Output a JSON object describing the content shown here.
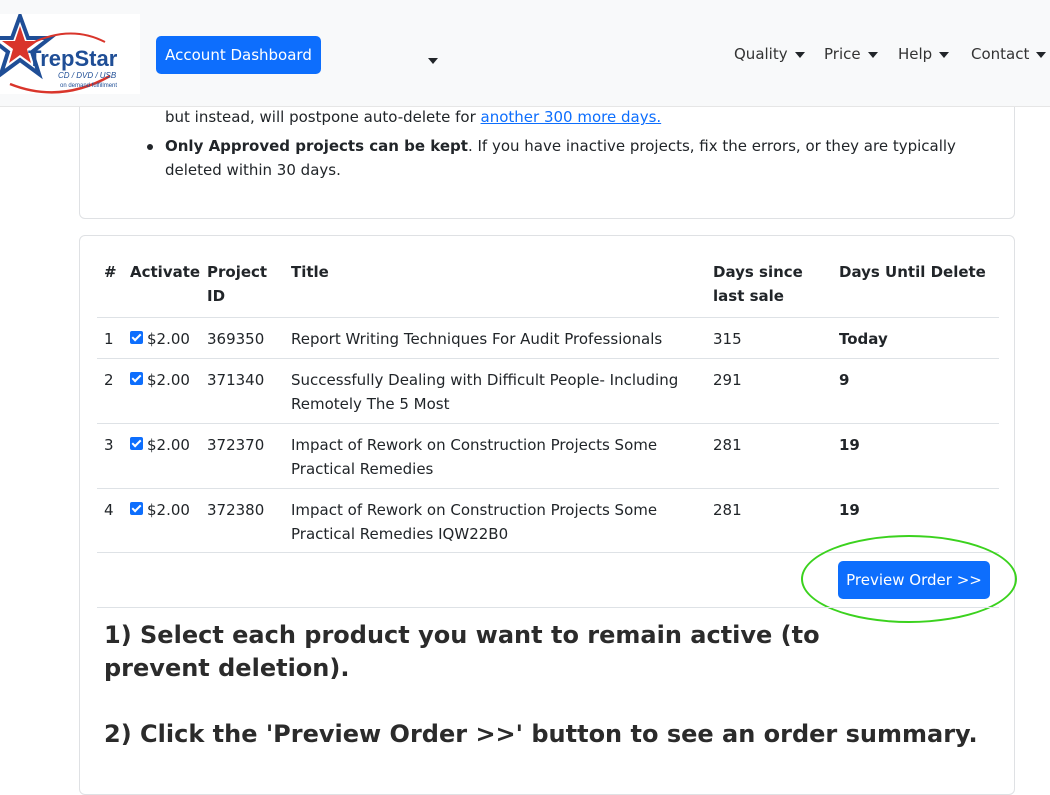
{
  "navbar": {
    "logo_text": "TrepStar",
    "logo_sub": "CD / DVD / USB",
    "logo_tagline": "on demand fulfillment",
    "dashboard_label": "Account Dashboard",
    "menu": [
      {
        "label": "Quality"
      },
      {
        "label": "Price"
      },
      {
        "label": "Help"
      },
      {
        "label": "Contact"
      }
    ]
  },
  "notice": {
    "line1_prefix": "but instead, will postpone auto-delete for ",
    "line1_link": "another 300 more days.",
    "bullet2_bold": "Only Approved projects can be kept",
    "bullet2_rest": ". If you have inactive projects, fix the errors, or they are typically deleted within 30 days."
  },
  "table": {
    "headers": {
      "num": "#",
      "activate": "Activate",
      "project_id": "Project ID",
      "title": "Title",
      "days_since": "Days since last sale",
      "days_until": "Days Until Delete"
    },
    "rows": [
      {
        "num": "1",
        "price": "$2.00",
        "checked": true,
        "id": "369350",
        "title": "Report Writing Techniques For Audit Professionals",
        "days_since": "315",
        "days_until": "Today"
      },
      {
        "num": "2",
        "price": "$2.00",
        "checked": true,
        "id": "371340",
        "title": "Successfully Dealing with Difficult People- Including Remotely The 5 Most",
        "days_since": "291",
        "days_until": "9"
      },
      {
        "num": "3",
        "price": "$2.00",
        "checked": true,
        "id": "372370",
        "title": "Impact of Rework on Construction Projects Some Practical Remedies",
        "days_since": "281",
        "days_until": "19"
      },
      {
        "num": "4",
        "price": "$2.00",
        "checked": true,
        "id": "372380",
        "title": "Impact of Rework on Construction Projects Some Practical Remedies IQW22B0",
        "days_since": "281",
        "days_until": "19"
      }
    ]
  },
  "preview_button": "Preview Order >>",
  "instructions": {
    "step1": "1) Select each product you want to remain active (to prevent deletion).",
    "step2": "2) Click the 'Preview Order >>' button to see an order summary."
  },
  "colors": {
    "primary": "#0d6efd",
    "highlight_ring": "#3bd21e",
    "navbar_bg": "#f8f9fa",
    "logo_red": "#d9352b",
    "logo_blue": "#1f4e96"
  }
}
